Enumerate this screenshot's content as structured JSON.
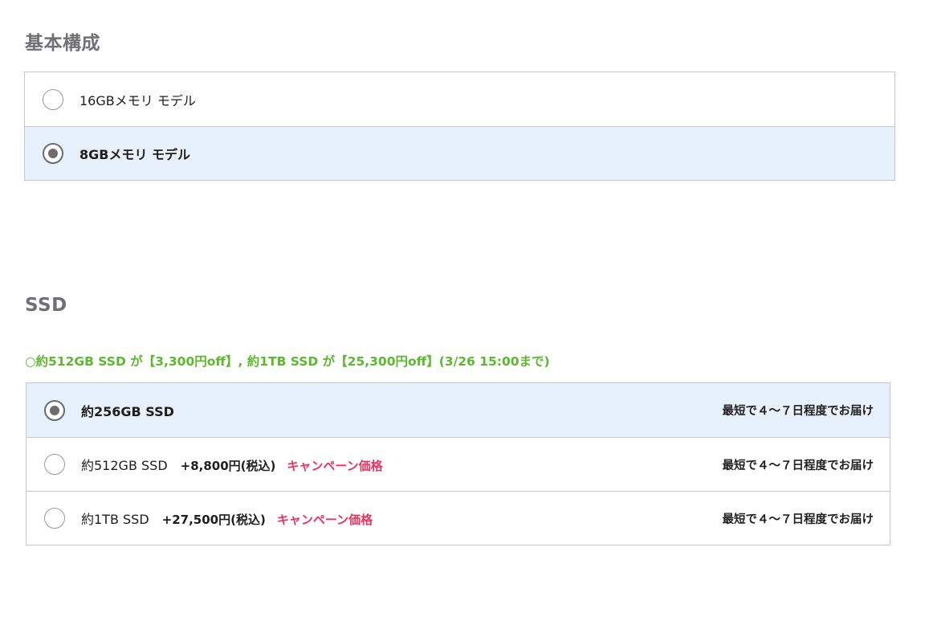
{
  "basic_config": {
    "title": "基本構成",
    "options": [
      {
        "label": "16GBメモリ モデル",
        "selected": false
      },
      {
        "label": "8GBメモリ モデル",
        "selected": true
      }
    ]
  },
  "ssd": {
    "title": "SSD",
    "notice": "○約512GB SSD が【3,300円off】, 約1TB SSD が【25,300円off】(3/26 15:00まで)",
    "colors": {
      "notice": "#5cb82e",
      "campaign": "#e8345f",
      "selected_bg": "#e6f1fc"
    },
    "options": [
      {
        "label": "約256GB SSD",
        "price": "",
        "campaign": "",
        "delivery": "最短で４〜７日程度でお届け",
        "selected": true
      },
      {
        "label": "約512GB SSD",
        "price": "+8,800円(税込)",
        "campaign": "キャンペーン価格",
        "delivery": "最短で４〜７日程度でお届け",
        "selected": false
      },
      {
        "label": "約1TB SSD",
        "price": "+27,500円(税込)",
        "campaign": "キャンペーン価格",
        "delivery": "最短で４〜７日程度でお届け",
        "selected": false
      }
    ]
  }
}
